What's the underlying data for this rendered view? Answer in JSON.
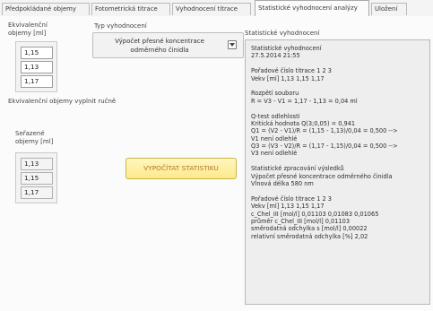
{
  "tabs": [
    {
      "label": "Předpokládané objemy",
      "active": false
    },
    {
      "label": "Fotometrická titrace",
      "active": false
    },
    {
      "label": "Vyhodnocení titrace",
      "active": false
    },
    {
      "label": "Statistické vyhodnocení analýzy",
      "active": true
    },
    {
      "label": "Uložení",
      "active": false
    }
  ],
  "left": {
    "equiv_label": "Ekvivalenční\nobjemy [ml]",
    "equiv_values": [
      "1,15",
      "1,13",
      "1,17"
    ],
    "manual_hint": "Ekvivalenční objemy vyplnit ručně",
    "sorted_label": "Seřazené\nobjemy [ml]",
    "sorted_values": [
      "1,13",
      "1,15",
      "1,17"
    ]
  },
  "evaluation": {
    "type_label": "Typ vyhodnocení",
    "selected": "Výpočet přesné koncentrace\nodměrného činidla",
    "dropdown_icon": "chevron-down-icon"
  },
  "calculate_button": "VYPOČÍTAT STATISTIKU",
  "accent": {
    "button_text": "#b0762c",
    "button_bg": "#fde98a"
  },
  "output": {
    "label": "Statistické vyhodnocení",
    "lines": [
      "Statistické vyhodnocení",
      "27.5.2014 21:55",
      "",
      "Pořadové číslo titrace 1 2 3",
      "Vekv [ml] 1,13 1,15 1,17",
      "",
      "Rozpětí souboru",
      "R = V3 - V1 = 1,17 - 1,13 = 0,04 ml",
      "",
      "Q-test odlehlosti",
      "Kritická hodnota Q(3;0,05) = 0,941",
      "Q1 = (V2 - V1)/R = (1,15 - 1,13)/0,04 = 0,500 -->",
      "V1 není odlehlé",
      "Q3 = (V3 - V2)/R = (1,17 - 1,15)/0,04 = 0,500 -->",
      "V3 není odlehlé",
      "",
      "Statistické zpracování výsledků",
      "Výpočet přesné koncentrace odměrného činidla",
      "Vlnová délka 580 nm",
      "",
      "Pořadové číslo titrace 1 2 3",
      "Vekv [ml] 1,13 1,15 1,17",
      "c_Chel_III [mol/l] 0,01103 0,01083 0,01065",
      "průměr c_Chel_III [mol/l] 0,01103",
      "směrodatná odchylka s [mol/l] 0,00022",
      "relativní směrodatná odchylka [%] 2,02"
    ]
  }
}
